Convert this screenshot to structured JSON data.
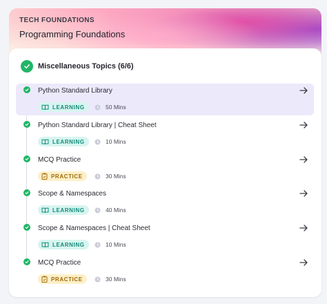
{
  "header": {
    "eyebrow": "TECH FOUNDATIONS",
    "course_title": "Programming Foundations"
  },
  "section": {
    "label": "Miscellaneous Topics (6/6)",
    "status_icon": "check-circle-icon"
  },
  "items": [
    {
      "title": "Python Standard Library",
      "badge": "LEARNING",
      "type": "learning",
      "duration": "50 Mins",
      "active": true
    },
    {
      "title": "Python Standard Library | Cheat Sheet",
      "badge": "LEARNING",
      "type": "learning",
      "duration": "10 Mins",
      "active": false
    },
    {
      "title": "MCQ Practice",
      "badge": "PRACTICE",
      "type": "practice",
      "duration": "30 Mins",
      "active": false
    },
    {
      "title": "Scope & Namespaces",
      "badge": "LEARNING",
      "type": "learning",
      "duration": "40 Mins",
      "active": false
    },
    {
      "title": "Scope & Namespaces | Cheat Sheet",
      "badge": "LEARNING",
      "type": "learning",
      "duration": "10 Mins",
      "active": false
    },
    {
      "title": "MCQ Practice",
      "badge": "PRACTICE",
      "type": "practice",
      "duration": "30 Mins",
      "active": false
    }
  ],
  "colors": {
    "complete_green": "#22b567",
    "learning_bg": "#d7f5f0",
    "learning_text": "#148a79",
    "practice_bg": "#fdf0c8",
    "practice_text": "#a06a0a",
    "active_row": "#ece9fb"
  }
}
